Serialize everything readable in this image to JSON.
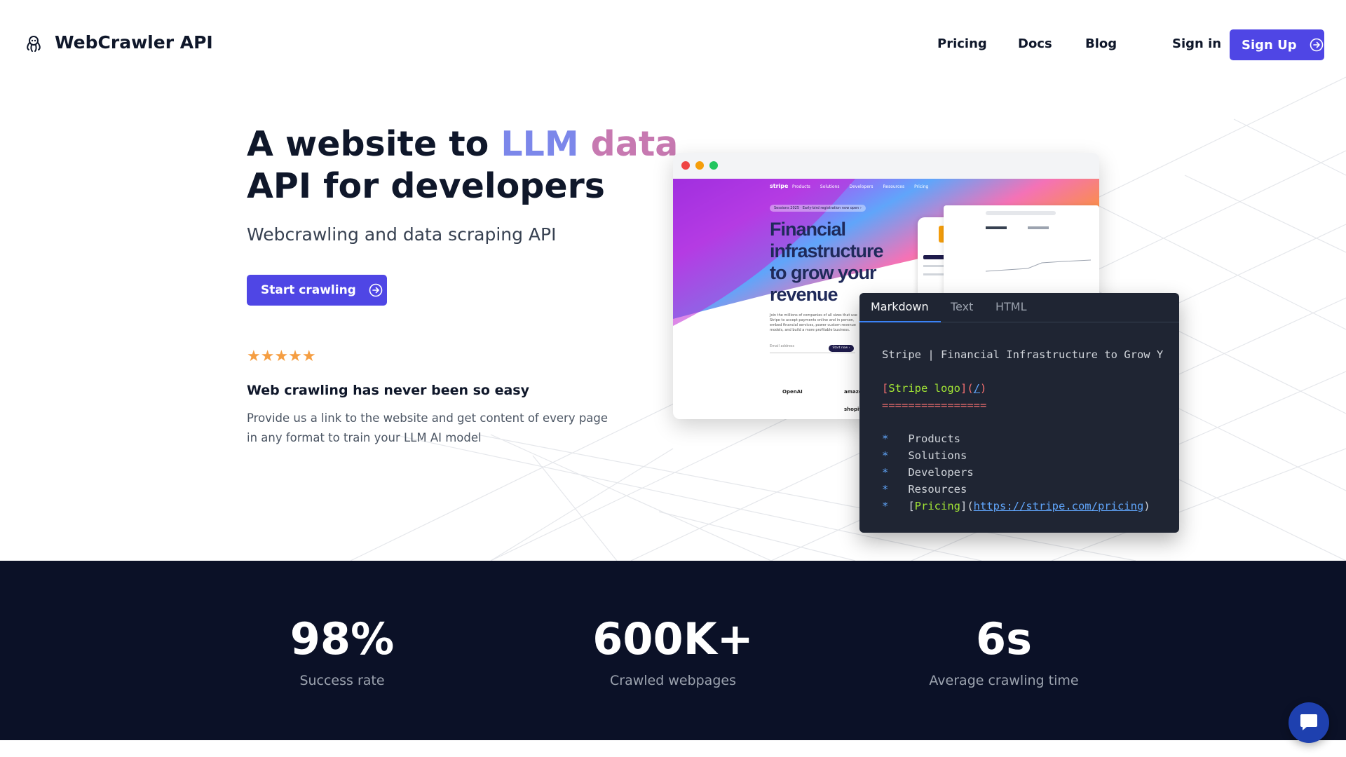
{
  "header": {
    "logo_text": "WebCrawler API",
    "nav": [
      {
        "label": "Pricing"
      },
      {
        "label": "Docs"
      },
      {
        "label": "Blog"
      }
    ],
    "signin_label": "Sign in",
    "signup_label": "Sign Up"
  },
  "hero": {
    "title_part1": "A website to ",
    "title_llm": "LLM",
    "title_data": "data",
    "title_line2": "API for developers",
    "subtitle": "Webcrawling and data scraping API",
    "cta_label": "Start crawling",
    "stars": "★★★★★",
    "feature_title": "Web crawling has never been so easy",
    "feature_desc": "Provide us a link to the website and get content of every page in any format to train your LLM AI model"
  },
  "preview": {
    "stripe_logo": "stripe",
    "stripe_nav": [
      "Products",
      "Solutions",
      "Developers",
      "Resources",
      "Pricing"
    ],
    "stripe_pill": "Sessions 2025 · Early-bird registration now open ›",
    "stripe_headline_1": "Financial",
    "stripe_headline_2": "infrastructure",
    "stripe_headline_3": "to grow your",
    "stripe_headline_4": "revenue",
    "stripe_small": "Join the millions of companies of all sizes that use Stripe to accept payments online and in person, embed financial services, power custom revenue models, and build a more profitable business.",
    "stripe_email": "Email address",
    "stripe_start": "Start now ›",
    "brands": [
      "OpenAI",
      "amazon",
      "shopify"
    ]
  },
  "code_panel": {
    "tabs": [
      "Markdown",
      "Text",
      "HTML"
    ],
    "line_title": "Stripe | Financial Infrastructure to Grow Y",
    "logo_label": "Stripe logo",
    "logo_url": "/",
    "underline": "================",
    "items": [
      "Products",
      "Solutions",
      "Developers",
      "Resources"
    ],
    "pricing_label": "Pricing",
    "pricing_url": "https://stripe.com/pricing"
  },
  "stats": [
    {
      "value": "98%",
      "label": "Success rate"
    },
    {
      "value": "600K+",
      "label": "Crawled webpages"
    },
    {
      "value": "6s",
      "label": "Average crawling time"
    }
  ],
  "colors": {
    "accent": "#4f46e5",
    "llm": "#7c87ea",
    "data": "#c779b1",
    "stats_bg": "#0b1127",
    "star": "#f59e42"
  },
  "icons": {
    "logo": "octopus-icon",
    "arrow": "arrow-right-circle-icon",
    "chat": "chat-bubble-icon"
  }
}
